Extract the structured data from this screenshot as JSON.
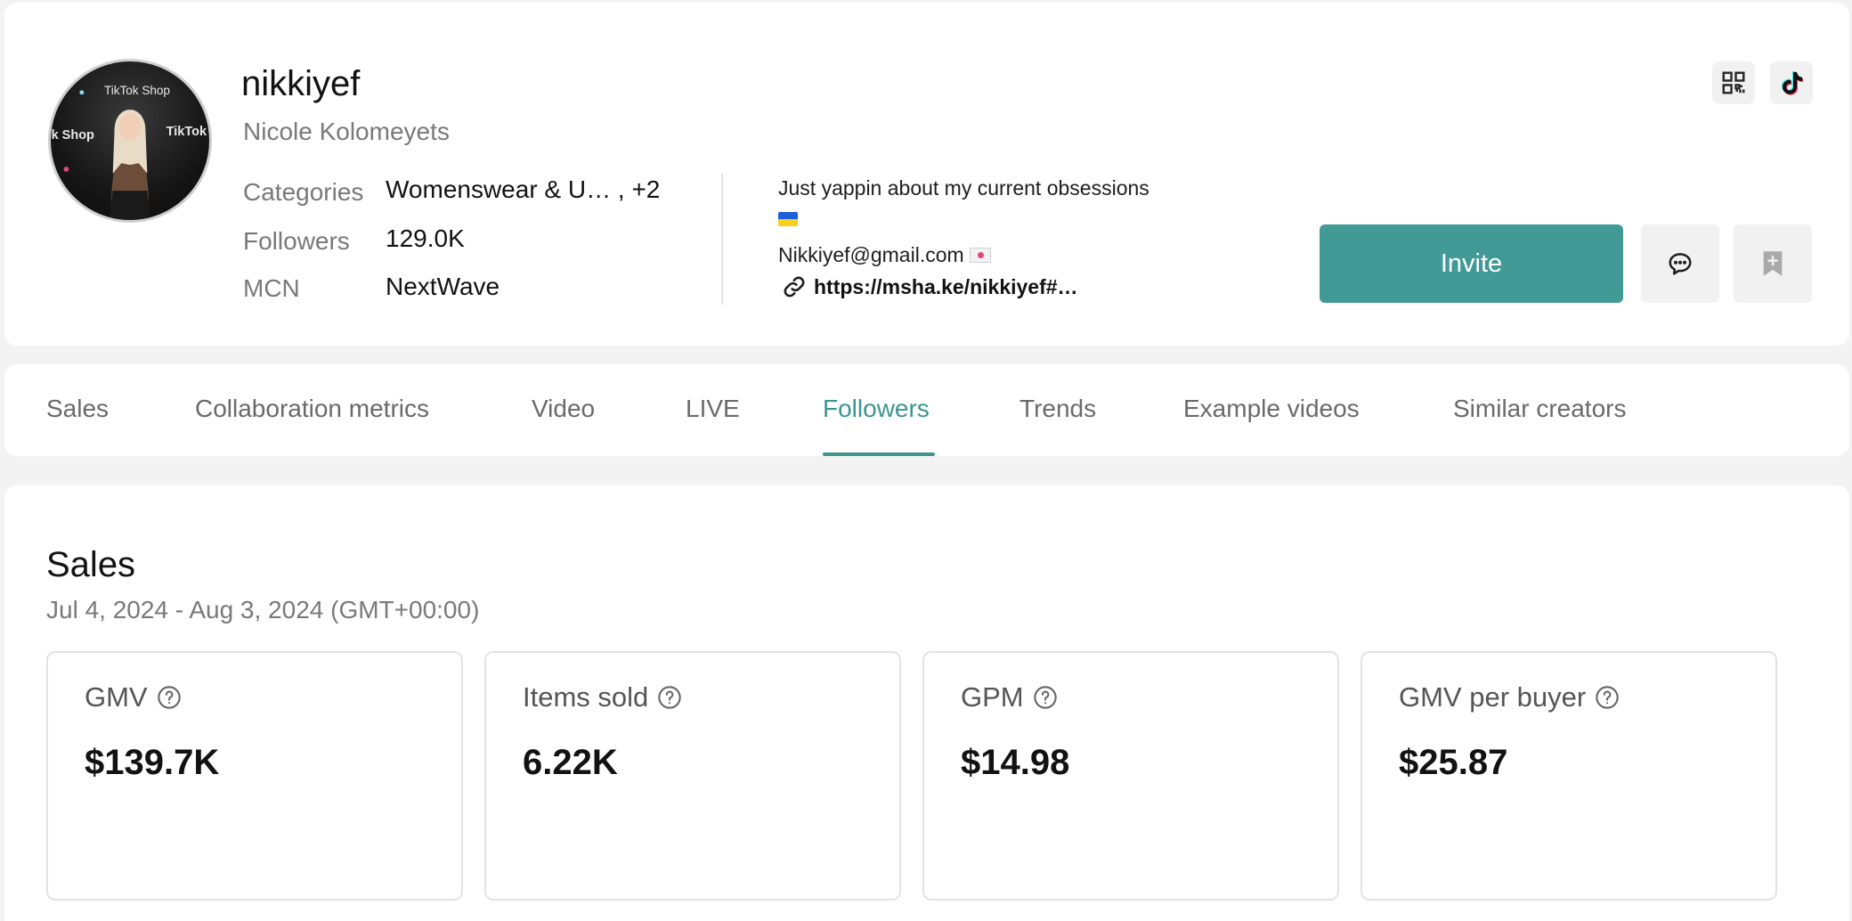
{
  "profile": {
    "username": "nikkiyef",
    "full_name": "Nicole Kolomeyets",
    "avatar_text": [
      "TikTok Shop",
      "TikTok Shop",
      "TikTok"
    ],
    "meta": [
      {
        "label": "Categories",
        "value": "Womenswear & U… , +2"
      },
      {
        "label": "Followers",
        "value": "129.0K"
      },
      {
        "label": "MCN",
        "value": "NextWave"
      }
    ],
    "bio_line1": "Just yappin about my current obsessions",
    "email": "Nikkiyef@gmail.com",
    "link": "https://msha.ke/nikkiyef#…",
    "invite_label": "Invite",
    "icons": {
      "qr": "qr-code-icon",
      "tiktok": "tiktok-logo-icon",
      "message": "chat-bubble-icon",
      "bookmark": "bookmark-add-icon",
      "link": "link-icon"
    },
    "colors": {
      "accent": "#419a96"
    }
  },
  "tabs": [
    {
      "label": "Sales"
    },
    {
      "label": "Collaboration metrics"
    },
    {
      "label": "Video"
    },
    {
      "label": "LIVE"
    },
    {
      "label": "Followers",
      "active": true
    },
    {
      "label": "Trends"
    },
    {
      "label": "Example videos"
    },
    {
      "label": "Similar creators"
    }
  ],
  "sales": {
    "title": "Sales",
    "date_range": "Jul 4, 2024 - Aug 3, 2024 (GMT+00:00)",
    "metrics": [
      {
        "label": "GMV",
        "value": "$139.7K"
      },
      {
        "label": "Items sold",
        "value": "6.22K"
      },
      {
        "label": "GPM",
        "value": "$14.98"
      },
      {
        "label": "GMV per buyer",
        "value": "$25.87"
      }
    ]
  }
}
